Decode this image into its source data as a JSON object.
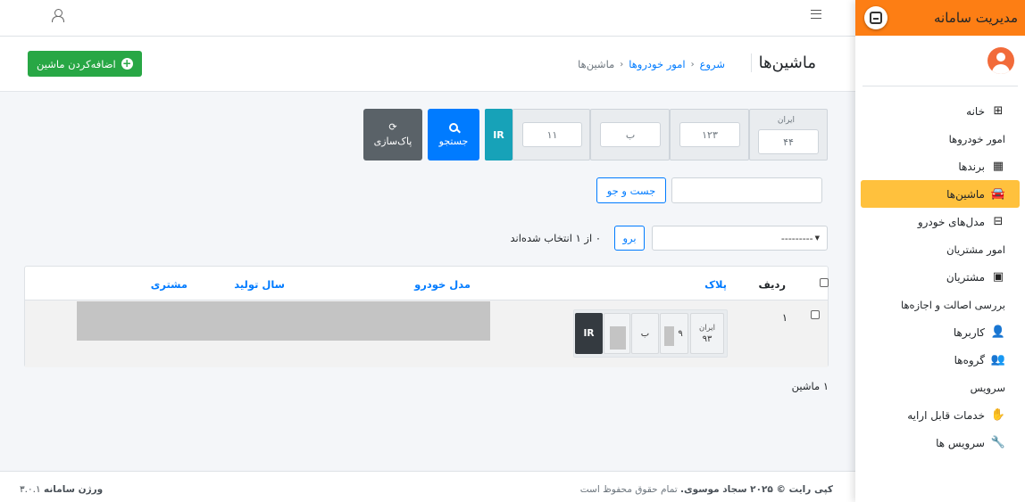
{
  "brand": {
    "title": "مدیریت سامانه"
  },
  "sidebar": {
    "items": [
      {
        "type": "link",
        "label": "خانه",
        "icon": "table-icon",
        "glyph": "⊞"
      },
      {
        "type": "header",
        "label": "امور خودروها"
      },
      {
        "type": "link",
        "label": "برندها",
        "icon": "building-icon",
        "glyph": "▦"
      },
      {
        "type": "link",
        "label": "ماشین‌ها",
        "icon": "car-icon",
        "glyph": "🚘",
        "active": true
      },
      {
        "type": "link",
        "label": "مدل‌های خودرو",
        "icon": "sitemap-icon",
        "glyph": "⊟"
      },
      {
        "type": "header",
        "label": "امور مشتریان"
      },
      {
        "type": "link",
        "label": "مشتریان",
        "icon": "id-card-icon",
        "glyph": "▣"
      },
      {
        "type": "header",
        "label": "بررسی اصالت و اجازه‌ها"
      },
      {
        "type": "link",
        "label": "کاربرها",
        "icon": "user-icon",
        "glyph": "👤"
      },
      {
        "type": "link",
        "label": "گروه‌ها",
        "icon": "users-icon",
        "glyph": "👥"
      },
      {
        "type": "header",
        "label": "سرویس"
      },
      {
        "type": "link",
        "label": "خدمات قابل ارایه",
        "icon": "hand-holding-icon",
        "glyph": "✋"
      },
      {
        "type": "link",
        "label": "سرویس ها",
        "icon": "wrench-icon",
        "glyph": "🔧"
      }
    ]
  },
  "header": {
    "title": "ماشین‌ها",
    "breadcrumb": [
      "شروع",
      "امور خودروها",
      "ماشین‌ها"
    ],
    "add_button": "اضافه‌کردن ماشین"
  },
  "plate_search": {
    "label": "ایران",
    "region_placeholder": "۴۴",
    "three_digits_placeholder": "۱۲۳",
    "letter_placeholder": "ب",
    "two_digits_placeholder": "۱۱",
    "country": "IR",
    "search_button": "جستجو",
    "clear_button": "پاک‌سازی"
  },
  "text_search": {
    "button": "جست و جو",
    "value": ""
  },
  "actions": {
    "select_value": "---------",
    "go_button": "برو",
    "selection_count": "۰ از ۱ انتخاب شده‌اند"
  },
  "table": {
    "columns": [
      "ردیف",
      "پلاک",
      "مدل خودرو",
      "سال تولید",
      "مشتری"
    ],
    "rows": [
      {
        "index": "۱",
        "plate": {
          "label": "ایران",
          "region": "۹۳",
          "three_digits": "۹",
          "letter": "ب",
          "country": "IR"
        }
      }
    ]
  },
  "total": "۱ ماشین",
  "footer": {
    "copyright_bold": "کپی رایت © ۲۰۲۵ سجاد موسوی.",
    "copyright_rest": "تمام حقوق محفوظ است",
    "version_label": "ورژن سامانه",
    "version": "۳.۰.۱"
  },
  "colors": {
    "brand": "#fd7e14",
    "active": "#ffc13d",
    "primary": "#007bff",
    "success": "#28a745",
    "info": "#17a2b8",
    "secondary": "#5a6268"
  }
}
